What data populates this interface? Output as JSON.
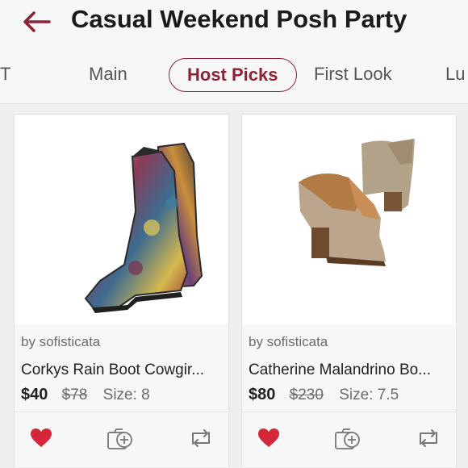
{
  "header": {
    "title": "Casual Weekend Posh Party"
  },
  "tabs": [
    {
      "label": "T"
    },
    {
      "label": "Main"
    },
    {
      "label": "Host Picks"
    },
    {
      "label": "First Look"
    },
    {
      "label": "Lu"
    }
  ],
  "listings": [
    {
      "seller": "by sofisticata",
      "title": "Corkys Rain Boot Cowgir...",
      "price": "$40",
      "original_price": "$78",
      "size": "Size: 8"
    },
    {
      "seller": "by sofisticata",
      "title": "Catherine Malandrino Bo...",
      "price": "$80",
      "original_price": "$230",
      "size": "Size: 7.5"
    }
  ],
  "colors": {
    "accent": "#8d2236",
    "heart": "#d4283a"
  },
  "icons": [
    "back-arrow-icon",
    "heart-icon",
    "add-to-bundle-icon",
    "share-icon"
  ]
}
